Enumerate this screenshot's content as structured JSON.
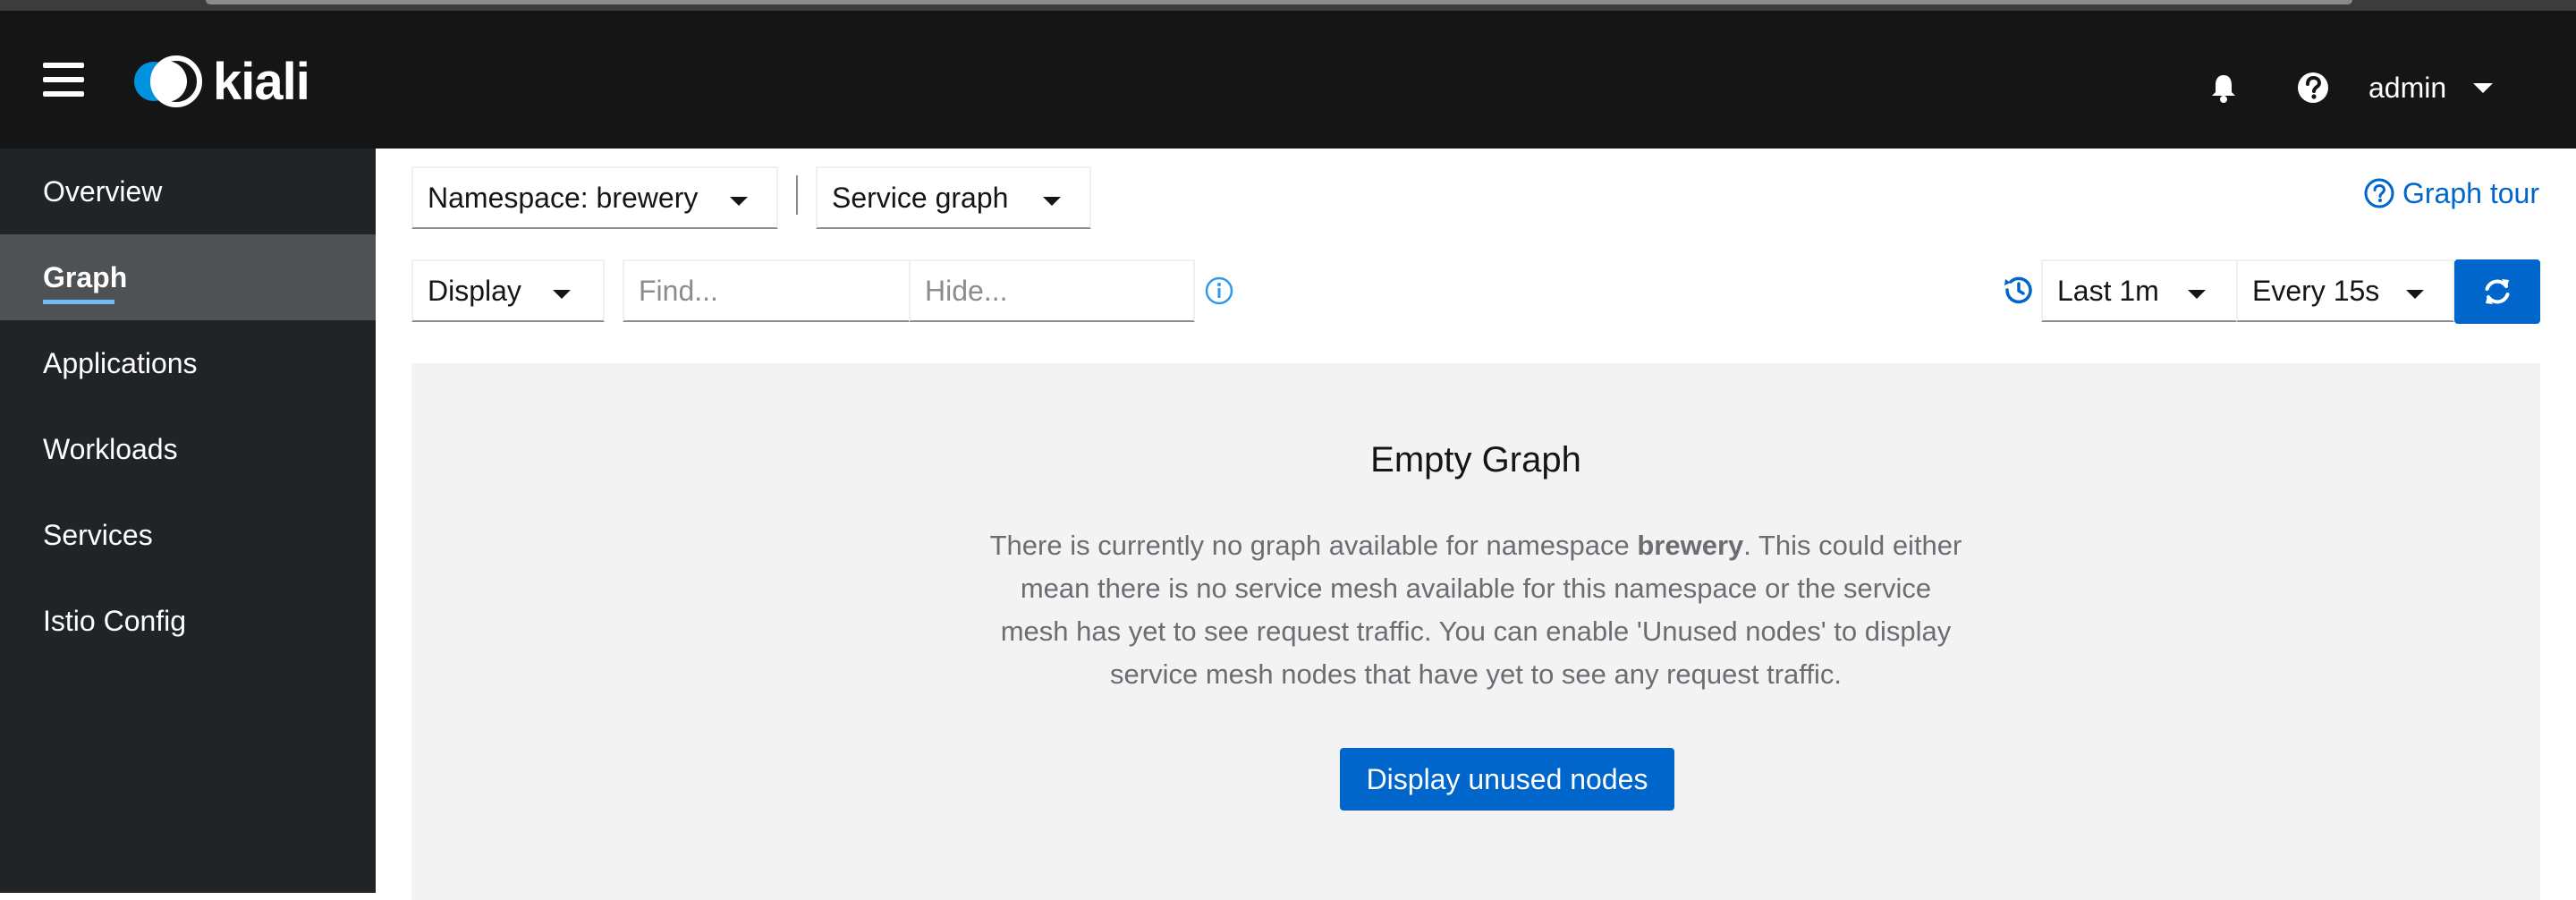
{
  "app": {
    "name": "kiali"
  },
  "masthead": {
    "user": "admin",
    "icons": [
      "hamburger-icon",
      "bell-icon",
      "help-icon",
      "caret-down-icon"
    ]
  },
  "sidebar": {
    "items": [
      {
        "label": "Overview",
        "active": false
      },
      {
        "label": "Graph",
        "active": true
      },
      {
        "label": "Applications",
        "active": false
      },
      {
        "label": "Workloads",
        "active": false
      },
      {
        "label": "Services",
        "active": false
      },
      {
        "label": "Istio Config",
        "active": false
      }
    ]
  },
  "toolbar": {
    "namespace": "Namespace: brewery",
    "graph_type": "Service graph",
    "graph_tour": "Graph tour",
    "display": "Display",
    "find_placeholder": "Find...",
    "hide_placeholder": "Hide...",
    "duration": "Last 1m",
    "refresh_interval": "Every 15s"
  },
  "empty_state": {
    "title": "Empty Graph",
    "body_before": "There is currently no graph available for namespace ",
    "namespace": "brewery",
    "body_after": ". This could either mean there is no service mesh available for this namespace or the service mesh has yet to see request traffic. You can enable 'Unused nodes' to display service mesh nodes that have yet to see any request traffic.",
    "button": "Display unused nodes"
  },
  "colors": {
    "accent": "#0066cc",
    "masthead": "#151515",
    "sidebar": "#212427",
    "sidebar_active": "#4f5255",
    "active_underline": "#73bcf7"
  }
}
